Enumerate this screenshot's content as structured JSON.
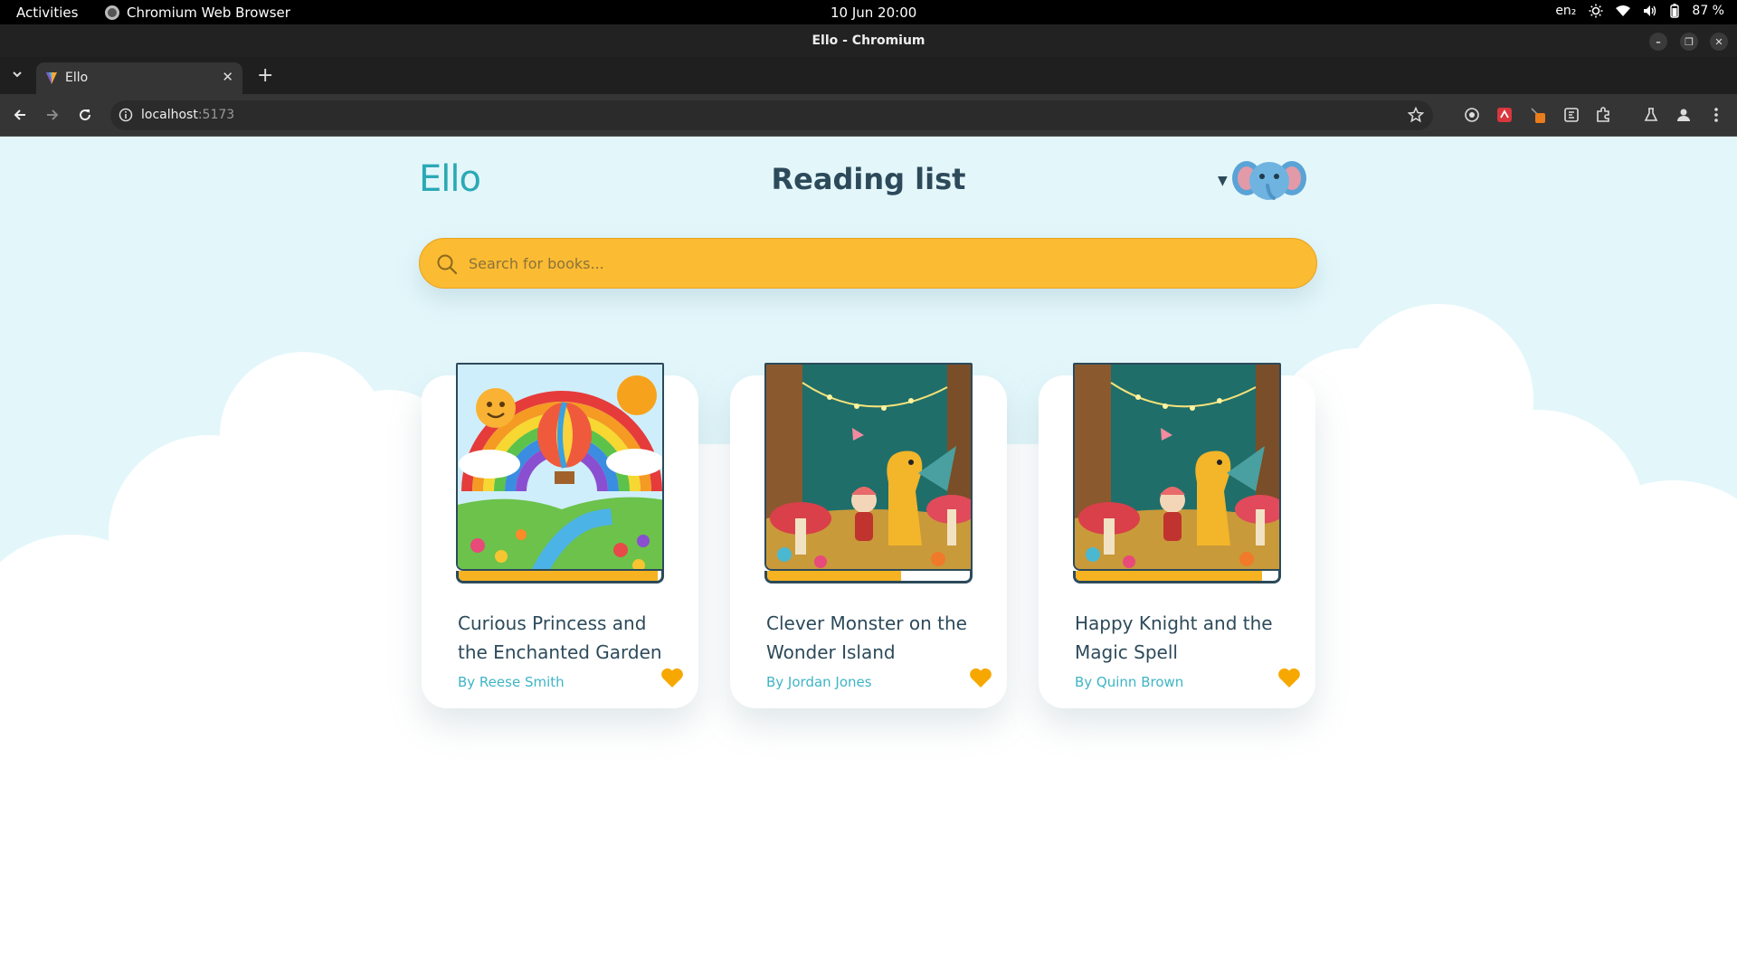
{
  "system": {
    "activities": "Activities",
    "app_name": "Chromium Web Browser",
    "clock": "10 Jun  20:00",
    "lang": "en₂",
    "battery": "87 %"
  },
  "window": {
    "title": "Ello - Chromium"
  },
  "tabs": [
    {
      "label": "Ello",
      "favicon": "ello-favicon"
    }
  ],
  "toolbar": {
    "url_host": "localhost",
    "url_port": ":5173",
    "extensions": [
      "extension-icon-1",
      "extension-icon-2",
      "extension-icon-3",
      "extension-icon-4",
      "puzzle-icon",
      "flask-icon",
      "profile-icon",
      "menu-icon"
    ]
  },
  "page": {
    "logo": "Ello",
    "title": "Reading list",
    "search_placeholder": "Search for books...",
    "accent": "#fbbb33",
    "teal": "#3fb4c6",
    "books": [
      {
        "title": "Curious Princess and the Enchanted Garden",
        "author": "By Reese Smith",
        "progress": 0.98,
        "favorite": true,
        "cover": "rainbow-balloon"
      },
      {
        "title": "Clever Monster on the Wonder Island",
        "author": "By Jordan Jones",
        "progress": 0.66,
        "favorite": true,
        "cover": "forest-dragon"
      },
      {
        "title": "Happy Knight and the Magic Spell",
        "author": "By Quinn Brown",
        "progress": 0.92,
        "favorite": true,
        "cover": "forest-dragon"
      }
    ]
  }
}
